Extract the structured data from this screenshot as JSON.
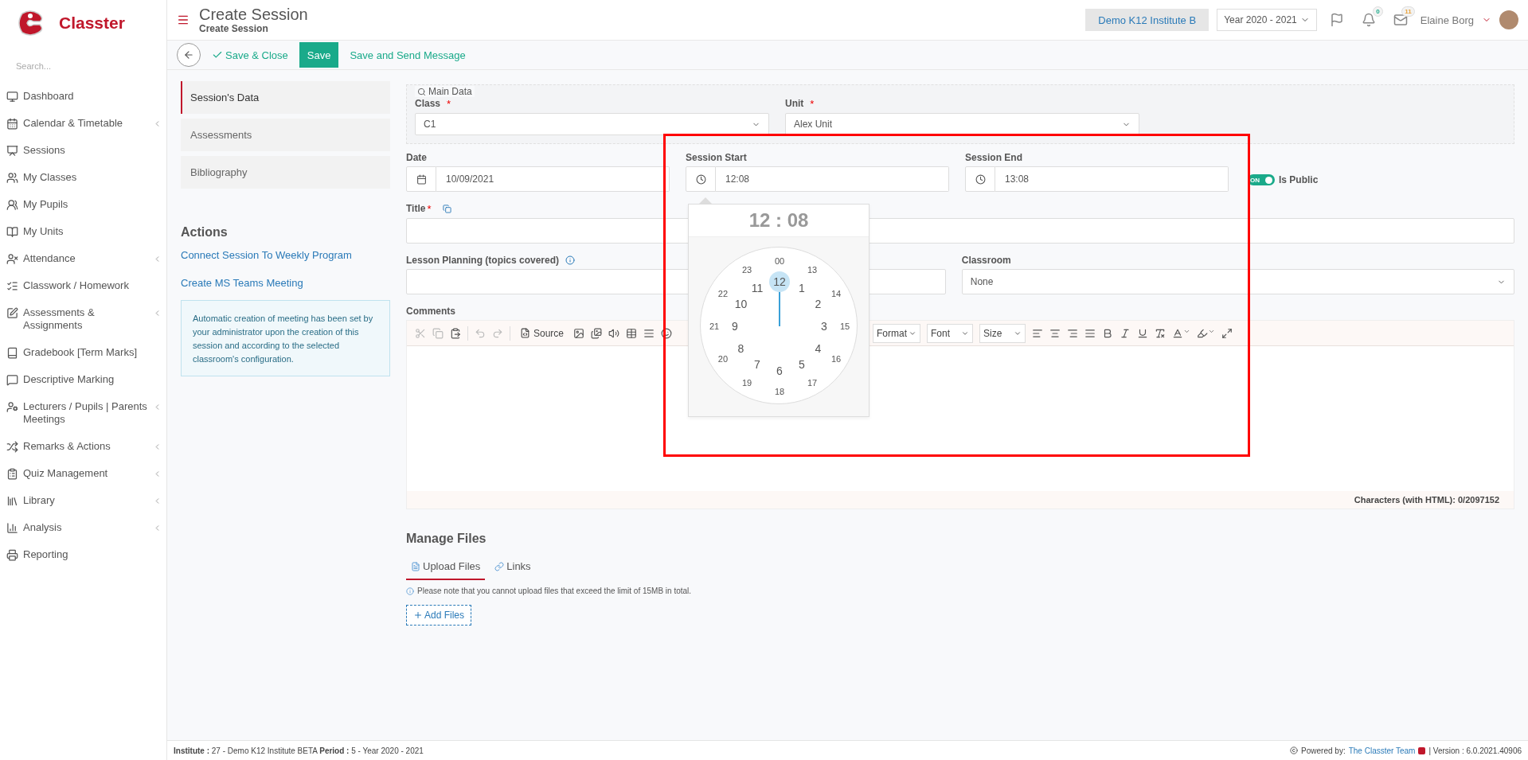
{
  "brand": {
    "name": "Classter"
  },
  "sidebar": {
    "search_placeholder": "Search...",
    "items": [
      {
        "label": "Dashboard",
        "submenu": false
      },
      {
        "label": "Calendar & Timetable",
        "submenu": true
      },
      {
        "label": "Sessions",
        "submenu": false
      },
      {
        "label": "My Classes",
        "submenu": false
      },
      {
        "label": "My Pupils",
        "submenu": false
      },
      {
        "label": "My Units",
        "submenu": false
      },
      {
        "label": "Attendance",
        "submenu": true
      },
      {
        "label": "Classwork / Homework",
        "submenu": false
      },
      {
        "label": "Assessments & Assignments",
        "submenu": true
      },
      {
        "label": "Gradebook [Term Marks]",
        "submenu": false
      },
      {
        "label": "Descriptive Marking",
        "submenu": false
      },
      {
        "label": "Lecturers / Pupils | Parents Meetings",
        "submenu": true
      },
      {
        "label": "Remarks & Actions",
        "submenu": true
      },
      {
        "label": "Quiz Management",
        "submenu": true
      },
      {
        "label": "Library",
        "submenu": true
      },
      {
        "label": "Analysis",
        "submenu": true
      },
      {
        "label": "Reporting",
        "submenu": false
      }
    ]
  },
  "header": {
    "title": "Create Session",
    "subtitle": "Create Session",
    "institute": "Demo K12 Institute B",
    "year": "Year 2020 - 2021",
    "notifications": "0",
    "messages": "11",
    "user": "Elaine Borg"
  },
  "toolbar": {
    "save_close": "Save & Close",
    "save": "Save",
    "save_send": "Save and Send Message"
  },
  "side_tabs": [
    {
      "label": "Session's Data",
      "selected": true
    },
    {
      "label": "Assessments",
      "selected": false
    },
    {
      "label": "Bibliography",
      "selected": false
    }
  ],
  "actions": {
    "title": "Actions",
    "links": [
      "Connect Session To Weekly Program",
      "Create MS Teams Meeting"
    ],
    "note": "Automatic creation of meeting has been set by your administrator upon the creation of this session and according to the selected classroom's configuration."
  },
  "main_data": {
    "legend": "Main Data",
    "class": {
      "label": "Class",
      "mark": "*",
      "value": "C1"
    },
    "unit": {
      "label": "Unit",
      "mark": "*",
      "value": "Alex Unit"
    }
  },
  "date": {
    "label": "Date",
    "value": "10/09/2021"
  },
  "session_start": {
    "label": "Session Start",
    "value": "12:08"
  },
  "session_end": {
    "label": "Session End",
    "value": "13:08"
  },
  "is_public": {
    "label": "Is Public",
    "text": "ON",
    "on": true
  },
  "title_field": {
    "label": "Title",
    "mark": "*"
  },
  "lesson_planning": {
    "label": "Lesson Planning (topics covered)"
  },
  "classroom": {
    "label": "Classroom",
    "value": "None"
  },
  "comments": {
    "label": "Comments",
    "source": "Source",
    "dropdowns": [
      "Format",
      "Font",
      "Size"
    ],
    "counter": "Characters (with HTML): 0/2097152",
    "tools": [
      {
        "kind": "icon",
        "disabled": true
      },
      {
        "kind": "icon",
        "disabled": true
      },
      {
        "kind": "icon",
        "disabled": false
      },
      {
        "kind": "sep"
      },
      {
        "kind": "icon",
        "disabled": true
      },
      {
        "kind": "icon",
        "disabled": true
      },
      {
        "kind": "sep"
      },
      {
        "kind": "source"
      },
      {
        "kind": "icon",
        "disabled": false
      },
      {
        "kind": "icon",
        "disabled": false
      },
      {
        "kind": "icon",
        "disabled": false
      },
      {
        "kind": "icon",
        "disabled": false
      },
      {
        "kind": "icon",
        "disabled": false
      },
      {
        "kind": "icon",
        "disabled": false
      }
    ],
    "tools2": [
      {
        "kind": "icon"
      },
      {
        "kind": "icon"
      },
      {
        "kind": "icon"
      },
      {
        "kind": "icon"
      },
      {
        "kind": "icon"
      },
      {
        "kind": "icon"
      },
      {
        "kind": "icon"
      },
      {
        "kind": "icon"
      },
      {
        "kind": "color"
      },
      {
        "kind": "color"
      },
      {
        "kind": "icon"
      }
    ]
  },
  "clock": {
    "time": "12 : 08",
    "outer": [
      "00",
      "13",
      "14",
      "15",
      "16",
      "17",
      "18",
      "19",
      "20",
      "21",
      "22",
      "23"
    ],
    "inner": [
      {
        "label": "12",
        "selected": true
      },
      {
        "label": "1",
        "selected": false
      },
      {
        "label": "2",
        "selected": false
      },
      {
        "label": "3",
        "selected": false
      },
      {
        "label": "4",
        "selected": false
      },
      {
        "label": "5",
        "selected": false
      },
      {
        "label": "6",
        "selected": false
      },
      {
        "label": "7",
        "selected": false
      },
      {
        "label": "8",
        "selected": false
      },
      {
        "label": "9",
        "selected": false
      },
      {
        "label": "10",
        "selected": false
      },
      {
        "label": "11",
        "selected": false
      }
    ]
  },
  "files": {
    "title": "Manage Files",
    "tabs": [
      {
        "label": "Upload Files",
        "selected": true
      },
      {
        "label": "Links",
        "selected": false
      }
    ],
    "note": "Please note that you cannot upload files that exceed the limit of 15MB in total.",
    "add": "Add Files"
  },
  "footer": {
    "left": "**Institute :** 27 - Demo K12 Institute BETA **Period :** 5 - Year 2020 - 2021",
    "powered": "Powered by:",
    "team": "The Classter Team",
    "version": "| Version : 6.0.2021.40906"
  }
}
